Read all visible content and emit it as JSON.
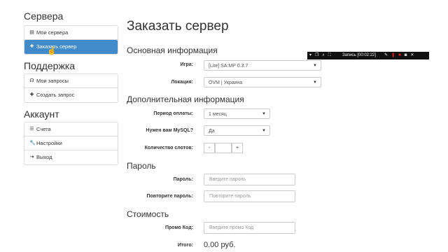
{
  "sidebar": {
    "servers_heading": "Сервера",
    "servers_items": [
      {
        "label": "Мои сервера",
        "icon": "server-icon"
      },
      {
        "label": "Заказать сервер",
        "icon": "plus-icon"
      }
    ],
    "support_heading": "Поддержка",
    "support_items": [
      {
        "label": "Мои запросы",
        "icon": "headset-icon"
      },
      {
        "label": "Создать запрос",
        "icon": "plus-icon"
      }
    ],
    "account_heading": "Аккаунт",
    "account_items": [
      {
        "label": "Счета",
        "icon": "list-icon"
      },
      {
        "label": "Настройки",
        "icon": "wrench-icon"
      },
      {
        "label": "Выход",
        "icon": "logout-icon"
      }
    ]
  },
  "main": {
    "title": "Заказать сервер",
    "basic_heading": "Основная информация",
    "game_label": "Игра:",
    "game_value": "[Lite] SA:MP 0.3.7",
    "location_label": "Локация:",
    "location_value": "OVM | Украина",
    "extra_heading": "Дополнительная информация",
    "period_label": "Период оплаты:",
    "period_value": "1 месяц",
    "mysql_label": "Нужен вам MySQL?",
    "mysql_value": "Да",
    "slots_label": "Количество слотов:",
    "slots_minus": "-",
    "slots_value": "",
    "slots_plus": "+",
    "password_heading": "Пароль",
    "password_label": "Пароль:",
    "password_placeholder": "Введите пароль",
    "repeat_label": "Повторите пароль:",
    "repeat_placeholder": "Повторите пароль",
    "cost_heading": "Стоимость",
    "promo_label": "Промо Код:",
    "promo_placeholder": "Введите промо Код",
    "total_label": "Итого:",
    "total_value": "0.00 руб."
  },
  "recorder": {
    "label": "Запись [00:02:22]"
  },
  "colors": {
    "accent": "#428bca",
    "border": "#dddddd",
    "recorder_bg": "#111111",
    "record_red": "#e02020"
  }
}
